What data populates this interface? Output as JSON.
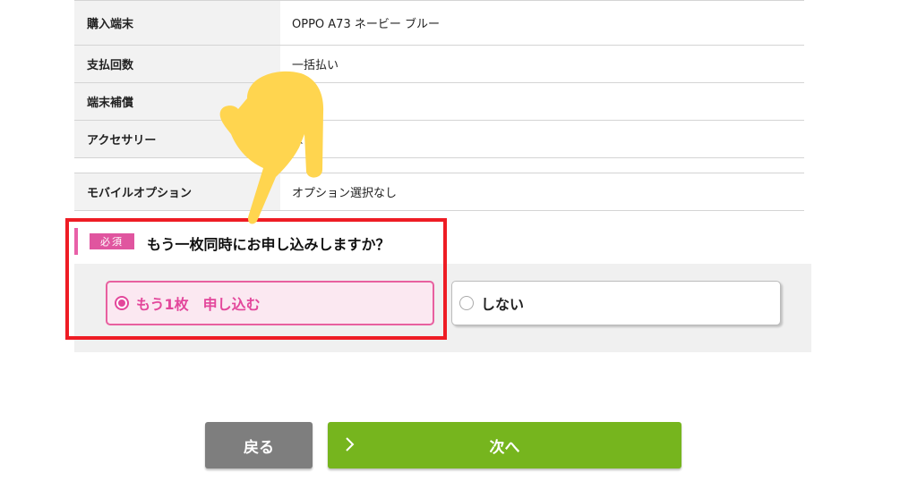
{
  "summary_rows": [
    {
      "label": "購入端末",
      "value": "OPPO A73  ネービー ブルー"
    },
    {
      "label": "支払回数",
      "value": "一括払い"
    },
    {
      "label": "端末補償",
      "value": ""
    },
    {
      "label": "アクセサリー",
      "value": "な"
    },
    {
      "label": "モバイルオプション",
      "value": "オプション選択なし"
    }
  ],
  "question": {
    "badge": "必須",
    "text": "もう一枚同時にお申し込みしますか？",
    "options": [
      {
        "label": "もう1枚　申し込む",
        "selected": true
      },
      {
        "label": "しない",
        "selected": false
      }
    ]
  },
  "buttons": {
    "back": "戻る",
    "next": "次へ"
  },
  "colors": {
    "accent_pink": "#e3479b",
    "highlight_red": "#ee1c24",
    "next_green": "#76b51e",
    "back_gray": "#7e7e7e",
    "hand_yellow": "#ffd54f"
  },
  "icons": {
    "next_chevron": "chevron-right-icon",
    "pointer": "pointing-hand-icon"
  }
}
